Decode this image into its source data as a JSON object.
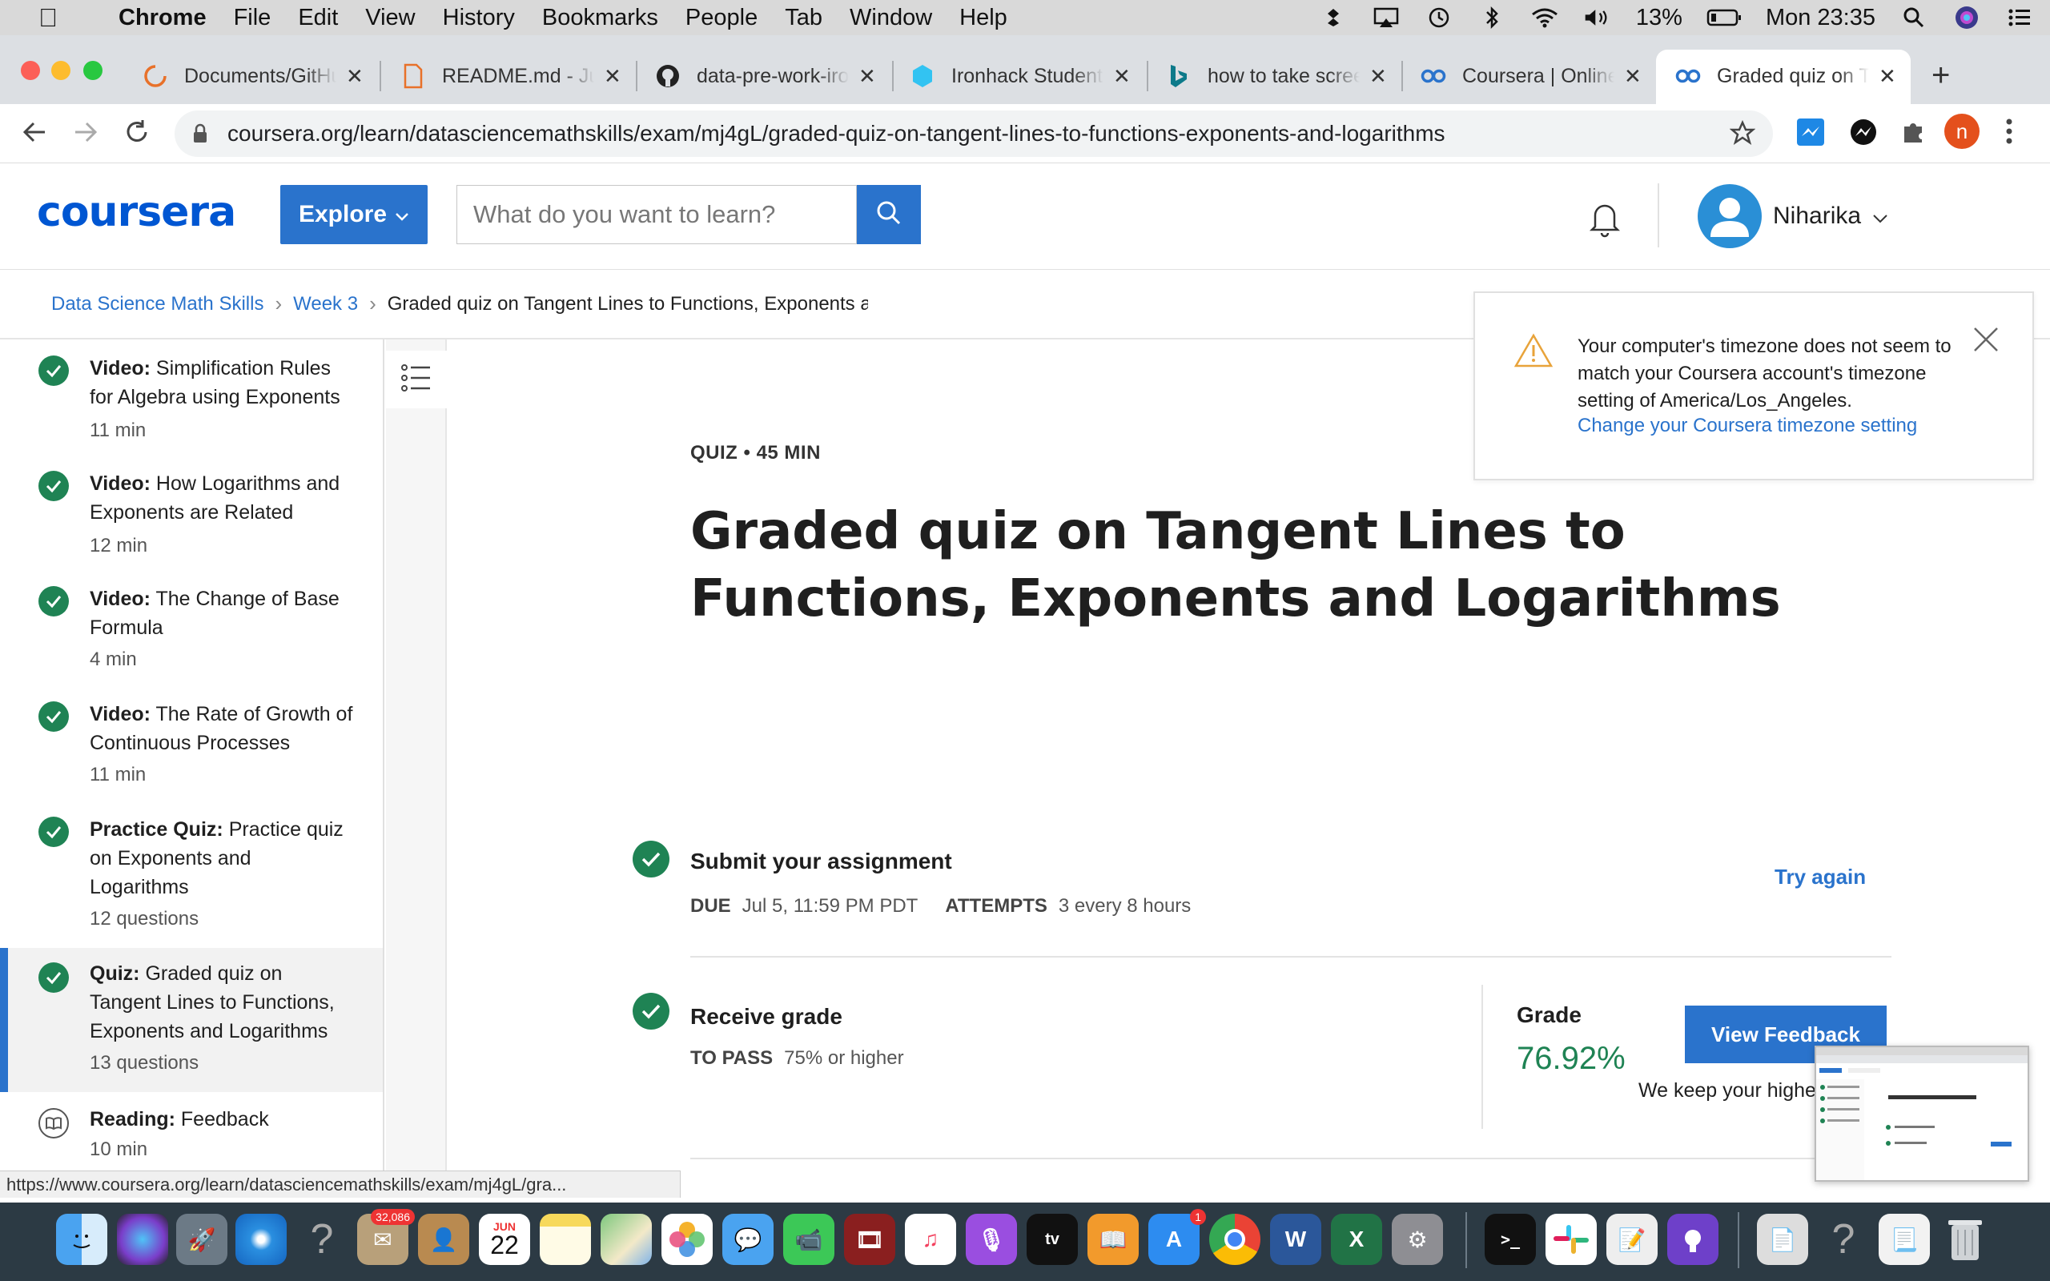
{
  "menubar": {
    "app": "Chrome",
    "menus": [
      "File",
      "Edit",
      "View",
      "History",
      "Bookmarks",
      "People",
      "Tab",
      "Window",
      "Help"
    ],
    "battery": "13%",
    "clock": "Mon 23:35"
  },
  "tabs": [
    {
      "title": "Documents/GitHub",
      "icon": "loading-spinner-icon"
    },
    {
      "title": "README.md - Jupyter",
      "icon": "file-icon"
    },
    {
      "title": "data-pre-work-ironhack",
      "icon": "github-icon"
    },
    {
      "title": "Ironhack Student Portal",
      "icon": "ironhack-icon"
    },
    {
      "title": "how to take screenshot",
      "icon": "bing-icon"
    },
    {
      "title": "Coursera | Online Courses",
      "icon": "coursera-icon"
    },
    {
      "title": "Graded quiz on Tangent",
      "icon": "coursera-icon",
      "active": true
    }
  ],
  "address": {
    "url": "coursera.org/learn/datasciencemathskills/exam/mj4gL/graded-quiz-on-tangent-lines-to-functions-exponents-and-logarithms"
  },
  "header": {
    "logo": "coursera",
    "explore": "Explore",
    "search_placeholder": "What do you want to learn?",
    "user": "Niharika",
    "profile_initial": "n"
  },
  "breadcrumb": {
    "course": "Data Science Math Skills",
    "week": "Week 3",
    "current": "Graded quiz on Tangent Lines to Functions, Exponents and Logarithms"
  },
  "sidebar": {
    "items": [
      {
        "type": "Video:",
        "title": "Simplification Rules for Algebra using Exponents",
        "meta": "11 min"
      },
      {
        "type": "Video:",
        "title": "How Logarithms and Exponents are Related",
        "meta": "12 min"
      },
      {
        "type": "Video:",
        "title": "The Change of Base Formula",
        "meta": "4 min"
      },
      {
        "type": "Video:",
        "title": "The Rate of Growth of Continuous Processes",
        "meta": "11 min"
      },
      {
        "type": "Practice Quiz:",
        "title": "Practice quiz on Exponents and Logarithms",
        "meta": "12 questions"
      },
      {
        "type": "Quiz:",
        "title": "Graded quiz on Tangent Lines to Functions, Exponents and Logarithms",
        "meta": "13 questions"
      },
      {
        "type": "Reading:",
        "title": "Feedback",
        "meta": "10 min"
      }
    ]
  },
  "quiz": {
    "meta": "QUIZ • 45 MIN",
    "title": "Graded quiz on Tangent Lines to Functions, Exponents and Logarithms",
    "submit": {
      "title": "Submit your assignment",
      "due_label": "DUE",
      "due_value": "Jul 5, 11:59 PM PDT",
      "attempts_label": "ATTEMPTS",
      "attempts_value": "3 every 8 hours",
      "try_again": "Try again"
    },
    "receive": {
      "title": "Receive grade",
      "pass_label": "TO PASS",
      "pass_value": "75% or higher",
      "grade_label": "Grade",
      "grade_value": "76.92%",
      "view_feedback": "View Feedback",
      "keep_note": "We keep your highest score"
    }
  },
  "timezone_notice": {
    "message": "Your computer's timezone does not seem to match your Coursera account's timezone setting of America/Los_Angeles.",
    "link": "Change your Coursera timezone setting"
  },
  "status_url": "https://www.coursera.org/learn/datasciencemathskills/exam/mj4gL/gra...",
  "dock": {
    "mail_badge": "32,086",
    "calendar_month": "JUN",
    "calendar_day": "22",
    "appstore_badge": "1"
  },
  "colors": {
    "accent": "#2a73cc",
    "success": "#1f8354",
    "warning": "#e8a33a"
  }
}
